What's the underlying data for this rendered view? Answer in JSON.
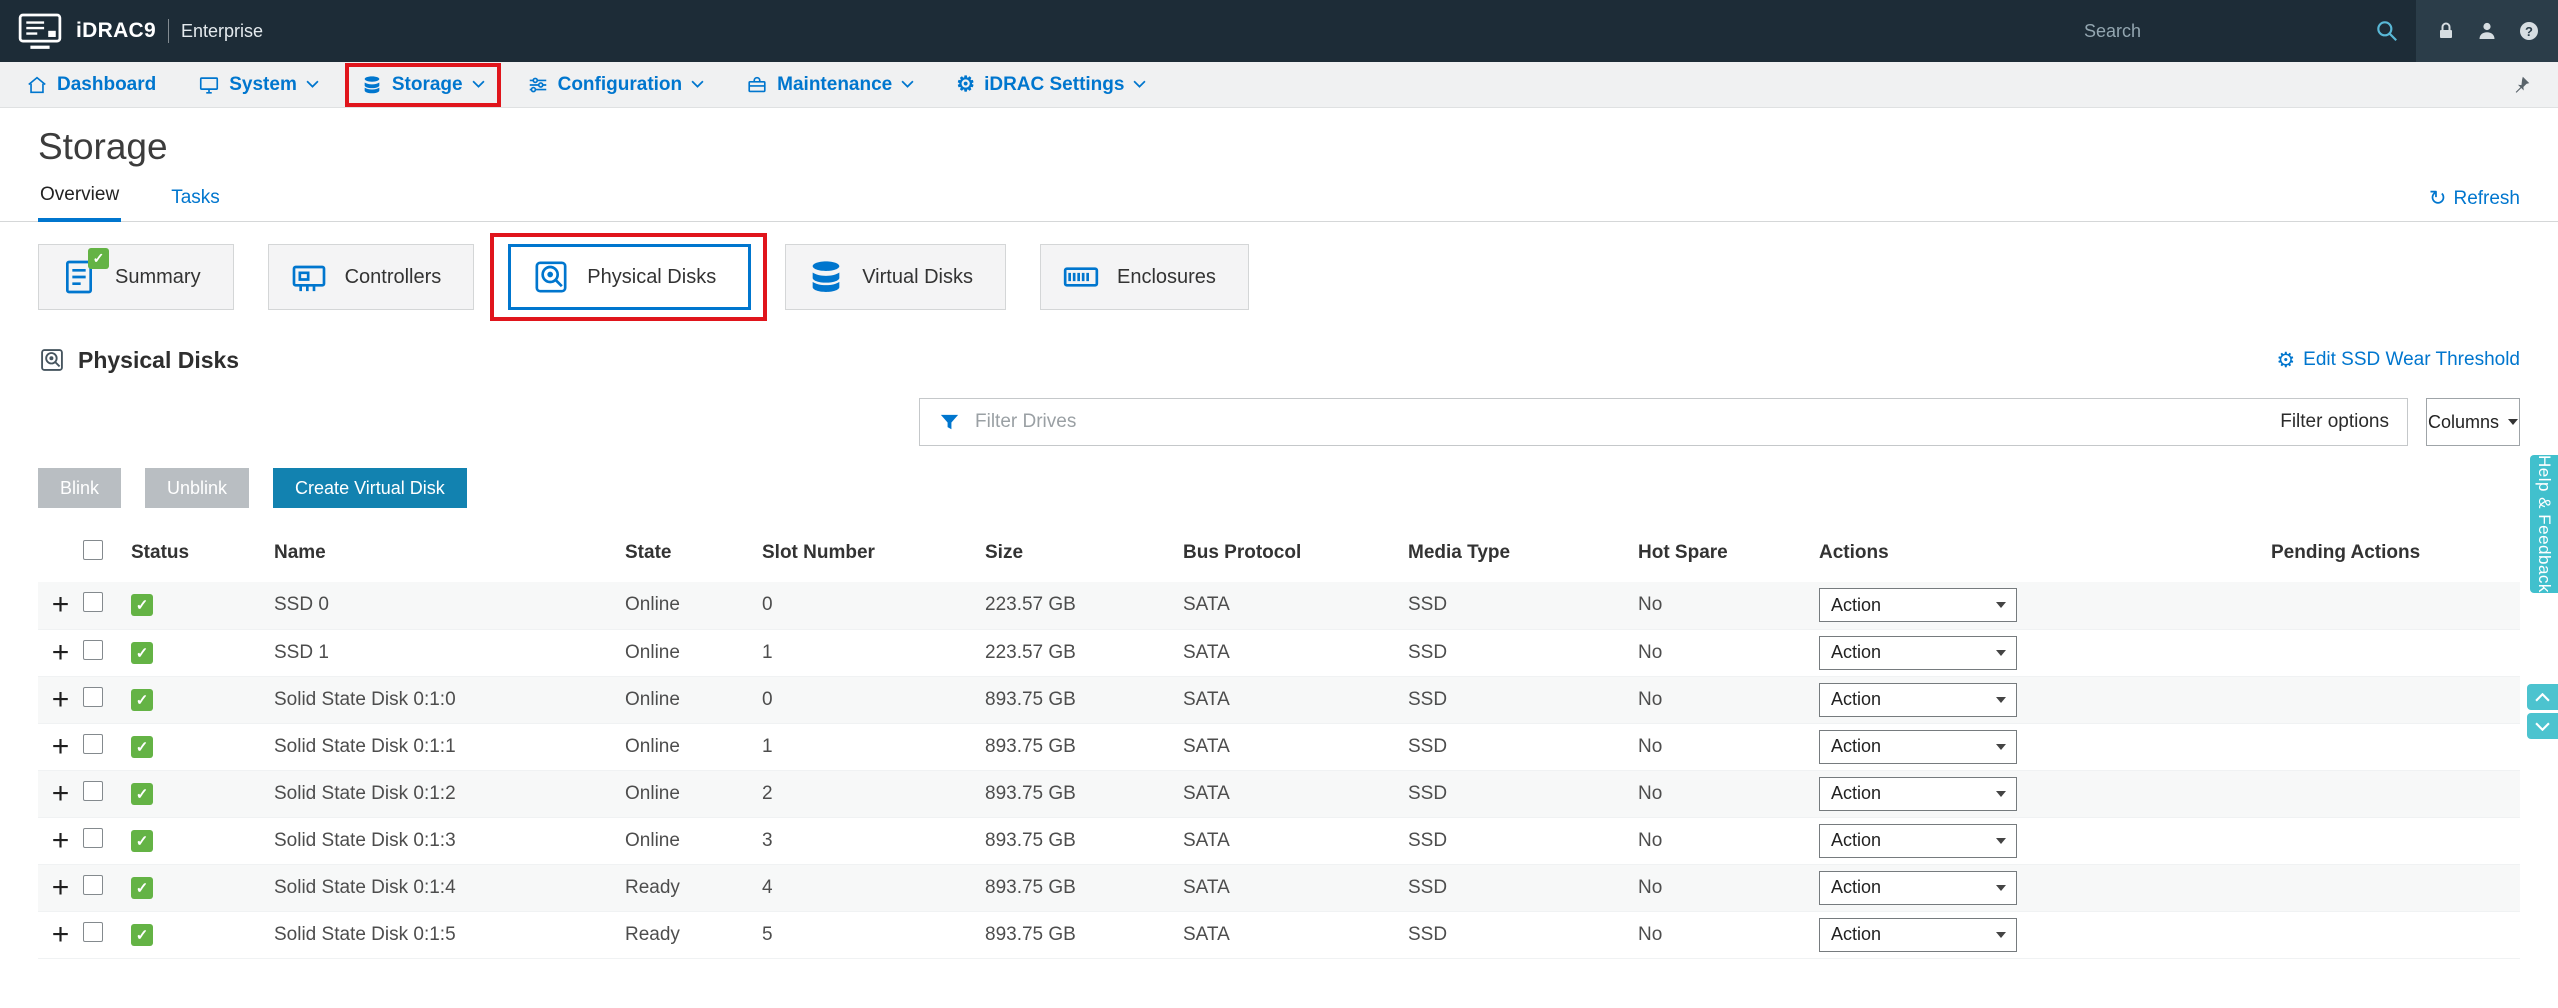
{
  "topbar": {
    "product": "iDRAC9",
    "edition": "Enterprise",
    "search_placeholder": "Search"
  },
  "nav": {
    "items": [
      {
        "label": "Dashboard"
      },
      {
        "label": "System"
      },
      {
        "label": "Storage"
      },
      {
        "label": "Configuration"
      },
      {
        "label": "Maintenance"
      },
      {
        "label": "iDRAC Settings"
      }
    ]
  },
  "page": {
    "title": "Storage",
    "tabs": [
      {
        "label": "Overview"
      },
      {
        "label": "Tasks"
      }
    ],
    "refresh_label": "Refresh"
  },
  "cards": [
    {
      "label": "Summary"
    },
    {
      "label": "Controllers"
    },
    {
      "label": "Physical Disks"
    },
    {
      "label": "Virtual Disks"
    },
    {
      "label": "Enclosures"
    }
  ],
  "section": {
    "title": "Physical Disks",
    "edit_ssd_link": "Edit SSD Wear Threshold"
  },
  "filter": {
    "placeholder": "Filter Drives",
    "options_label": "Filter options",
    "columns_label": "Columns"
  },
  "toolbar": {
    "blink_label": "Blink",
    "unblink_label": "Unblink",
    "create_vd_label": "Create Virtual Disk"
  },
  "table": {
    "headers": [
      "Status",
      "Name",
      "State",
      "Slot Number",
      "Size",
      "Bus Protocol",
      "Media Type",
      "Hot Spare",
      "Actions",
      "Pending Actions"
    ],
    "action_label": "Action",
    "rows": [
      {
        "status": "ok",
        "name": "SSD 0",
        "state": "Online",
        "slot": "0",
        "size": "223.57 GB",
        "bus": "SATA",
        "media": "SSD",
        "hot_spare": "No",
        "pending": ""
      },
      {
        "status": "ok",
        "name": "SSD 1",
        "state": "Online",
        "slot": "1",
        "size": "223.57 GB",
        "bus": "SATA",
        "media": "SSD",
        "hot_spare": "No",
        "pending": ""
      },
      {
        "status": "ok",
        "name": "Solid State Disk 0:1:0",
        "state": "Online",
        "slot": "0",
        "size": "893.75 GB",
        "bus": "SATA",
        "media": "SSD",
        "hot_spare": "No",
        "pending": ""
      },
      {
        "status": "ok",
        "name": "Solid State Disk 0:1:1",
        "state": "Online",
        "slot": "1",
        "size": "893.75 GB",
        "bus": "SATA",
        "media": "SSD",
        "hot_spare": "No",
        "pending": ""
      },
      {
        "status": "ok",
        "name": "Solid State Disk 0:1:2",
        "state": "Online",
        "slot": "2",
        "size": "893.75 GB",
        "bus": "SATA",
        "media": "SSD",
        "hot_spare": "No",
        "pending": ""
      },
      {
        "status": "ok",
        "name": "Solid State Disk 0:1:3",
        "state": "Online",
        "slot": "3",
        "size": "893.75 GB",
        "bus": "SATA",
        "media": "SSD",
        "hot_spare": "No",
        "pending": ""
      },
      {
        "status": "ok",
        "name": "Solid State Disk 0:1:4",
        "state": "Ready",
        "slot": "4",
        "size": "893.75 GB",
        "bus": "SATA",
        "media": "SSD",
        "hot_spare": "No",
        "pending": ""
      },
      {
        "status": "ok",
        "name": "Solid State Disk 0:1:5",
        "state": "Ready",
        "slot": "5",
        "size": "893.75 GB",
        "bus": "SATA",
        "media": "SSD",
        "hot_spare": "No",
        "pending": ""
      }
    ]
  },
  "side": {
    "help_tab_label": "Help & Feedback"
  },
  "colors": {
    "accent_blue": "#0076ce",
    "topbar_bg": "#1d2c37",
    "status_green": "#64b345",
    "annotation_red": "#e0151c",
    "help_tab_teal": "#41c0cd",
    "create_button_blue": "#1282b0",
    "disabled_button_gray": "#b9bec2"
  }
}
